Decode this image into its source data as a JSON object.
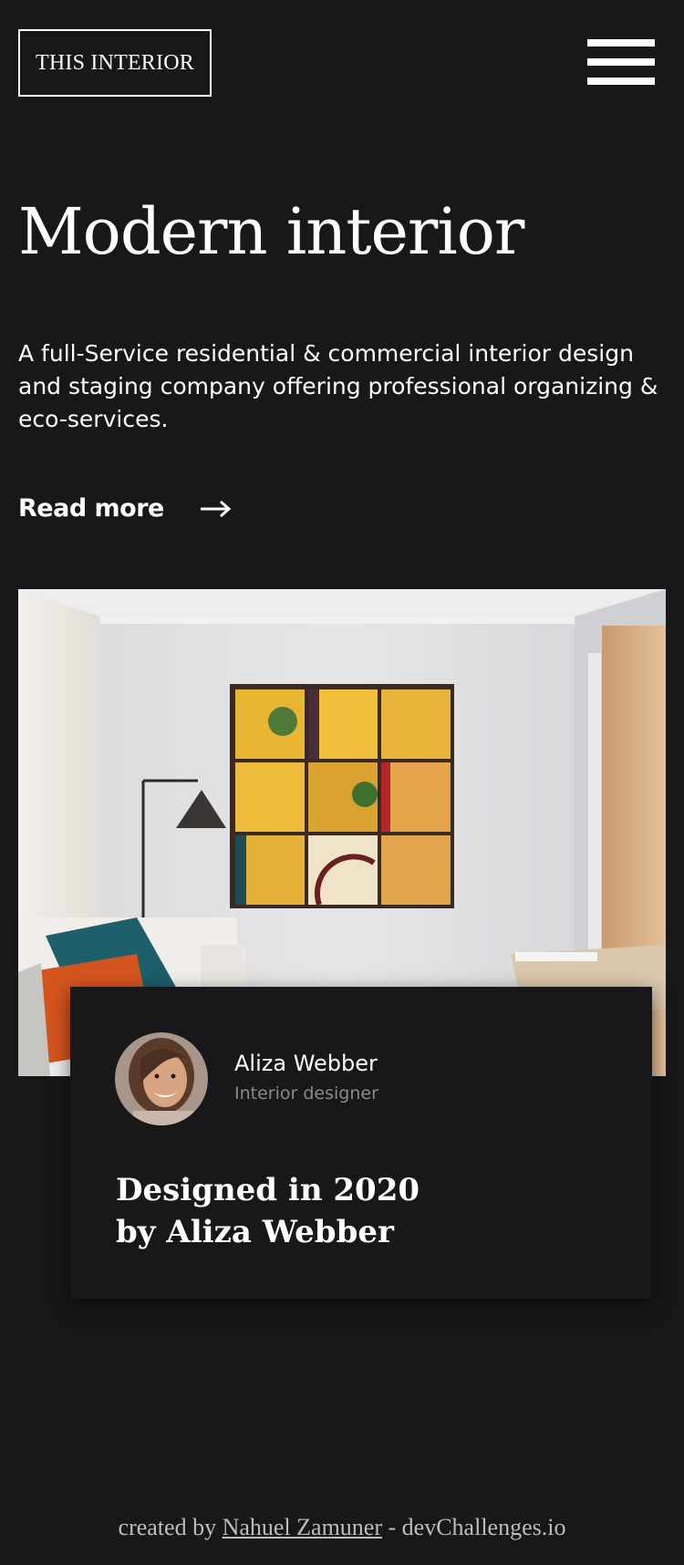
{
  "header": {
    "brand": "THIS INTERIOR",
    "menu_icon": "hamburger-menu-icon"
  },
  "hero": {
    "title": "Modern interior",
    "description": "A full-Service residential & commercial interior design and staging company offering professional organizing & eco-services.",
    "read_more": "Read more",
    "read_more_icon": "arrow-right-icon"
  },
  "card": {
    "name": "Aliza Webber",
    "role": "Interior designer",
    "title_line1": "Designed in 2020",
    "title_line2": "by Aliza Webber"
  },
  "footer": {
    "prefix": "created by",
    "author": "Nahuel Zamuner",
    "suffix": "- devChallenges.io"
  },
  "colors": {
    "background": "#18171a",
    "text": "#ffffff",
    "muted": "#8a8a8d",
    "footer_text": "#bdbdbd"
  }
}
